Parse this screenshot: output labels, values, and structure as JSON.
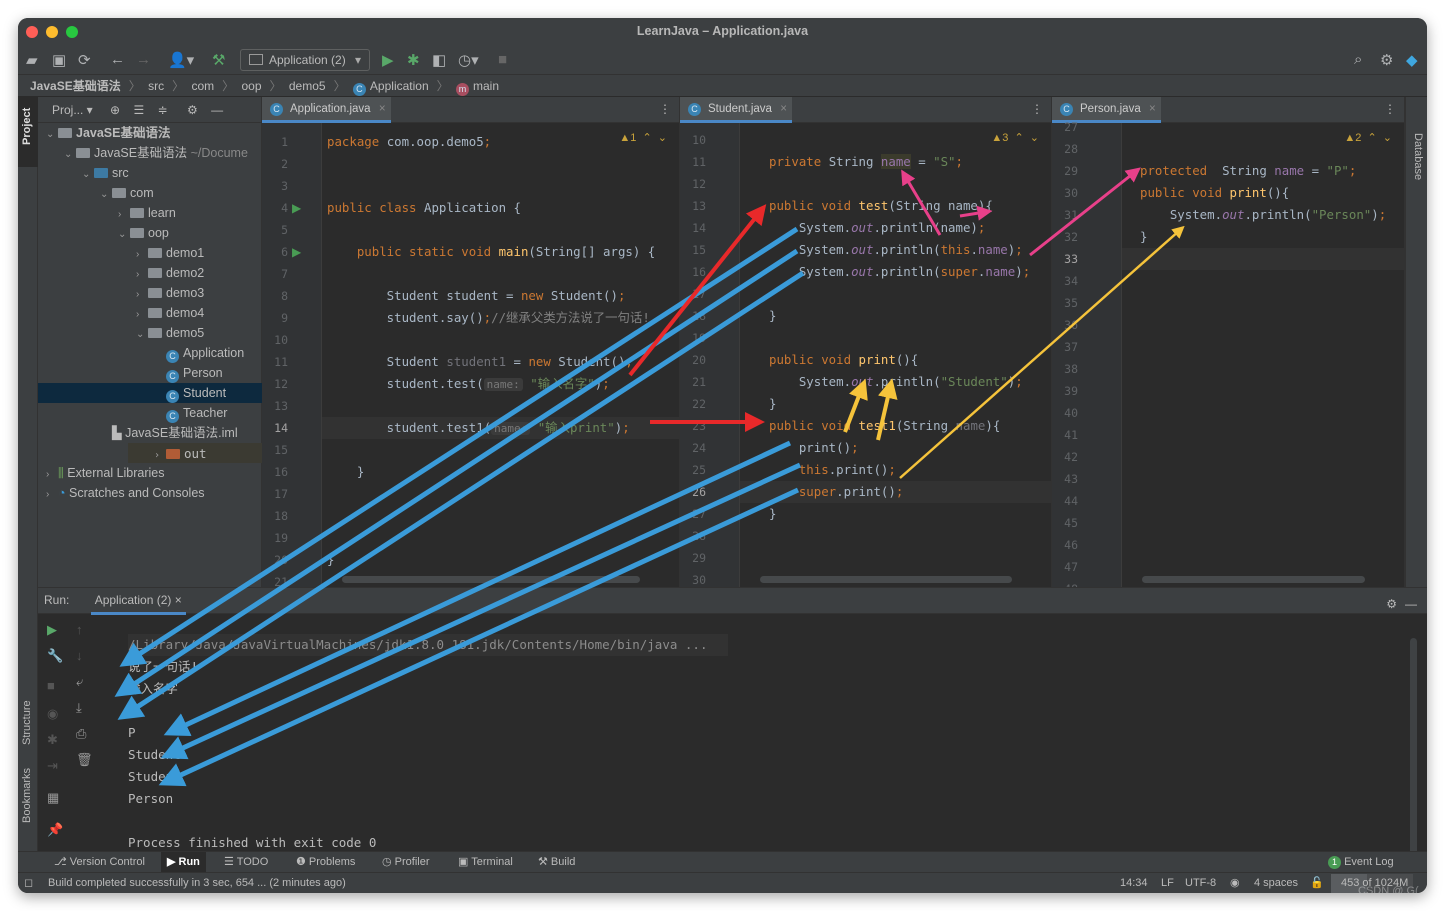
{
  "window": {
    "title": "LearnJava – Application.java"
  },
  "toolbar": {
    "run_config": "Application (2)",
    "icons": [
      "open-folder-icon",
      "save-icon",
      "sync-icon",
      "back-icon",
      "forward-icon",
      "user-icon",
      "build-hammer-icon",
      "run-icon",
      "debug-icon",
      "coverage-icon",
      "profile-icon",
      "stop-icon",
      "search-icon",
      "settings-icon",
      "jetbrains-icon"
    ]
  },
  "breadcrumb": [
    "JavaSE基础语法",
    "src",
    "com",
    "oop",
    "demo5",
    "Application",
    "main"
  ],
  "left_stripe": {
    "project": "Project",
    "structure": "Structure",
    "bookmarks": "Bookmarks"
  },
  "right_stripe": {
    "database": "Database"
  },
  "project": {
    "header": "Proj...",
    "tree": [
      {
        "label": "JavaSE基础语法",
        "depth": 0,
        "chev": "v",
        "kind": "module",
        "bold": true
      },
      {
        "label": "JavaSE基础语法",
        "suffix": "~/Docume",
        "depth": 1,
        "chev": "v",
        "kind": "module"
      },
      {
        "label": "src",
        "depth": 2,
        "chev": "v",
        "kind": "src"
      },
      {
        "label": "com",
        "depth": 3,
        "chev": "v",
        "kind": "pkg"
      },
      {
        "label": "learn",
        "depth": 4,
        "chev": ">",
        "kind": "pkg"
      },
      {
        "label": "oop",
        "depth": 4,
        "chev": "v",
        "kind": "pkg"
      },
      {
        "label": "demo1",
        "depth": 5,
        "chev": ">",
        "kind": "pkg"
      },
      {
        "label": "demo2",
        "depth": 5,
        "chev": ">",
        "kind": "pkg"
      },
      {
        "label": "demo3",
        "depth": 5,
        "chev": ">",
        "kind": "pkg"
      },
      {
        "label": "demo4",
        "depth": 5,
        "chev": ">",
        "kind": "pkg"
      },
      {
        "label": "demo5",
        "depth": 5,
        "chev": "v",
        "kind": "pkg"
      },
      {
        "label": "Application",
        "depth": 6,
        "chev": "",
        "kind": "class"
      },
      {
        "label": "Person",
        "depth": 6,
        "chev": "",
        "kind": "class"
      },
      {
        "label": "Student",
        "depth": 6,
        "chev": "",
        "kind": "class",
        "selected": true
      },
      {
        "label": "Teacher",
        "depth": 6,
        "chev": "",
        "kind": "class"
      },
      {
        "label": "JavaSE基础语法.iml",
        "depth": 3,
        "chev": "",
        "kind": "file"
      },
      {
        "label": "out",
        "depth": 1,
        "chev": ">",
        "kind": "out"
      },
      {
        "label": "External Libraries",
        "depth": 0,
        "chev": ">",
        "kind": "lib"
      },
      {
        "label": "Scratches and Consoles",
        "depth": 0,
        "chev": ">",
        "kind": "scratch"
      }
    ]
  },
  "editors": [
    {
      "tab": "Application.java",
      "warnings": "1",
      "first_line": 1,
      "last_line": 21,
      "current_line": 14,
      "lines": {
        "1": [
          [
            "package ",
            "kw"
          ],
          [
            "com.oop.demo5",
            ""
          ],
          [
            ";",
            "kw"
          ]
        ],
        "4": [
          [
            "public class ",
            "kw"
          ],
          [
            "Application {",
            ""
          ]
        ],
        "6": [
          [
            "    public static void ",
            "kw"
          ],
          [
            "main",
            "mth"
          ],
          [
            "(String[] args) {",
            ""
          ]
        ],
        "8": [
          [
            "        Student student = ",
            ""
          ],
          [
            "new ",
            "kw"
          ],
          [
            "Student()",
            ""
          ],
          [
            ";",
            "kw"
          ]
        ],
        "9": [
          [
            "        student.say()",
            ""
          ],
          [
            ";",
            "kw"
          ],
          [
            "//继承父类方法说了一句话!",
            "cmt"
          ]
        ],
        "11": [
          [
            "        Student ",
            ""
          ],
          [
            "student1",
            "gray"
          ],
          [
            " = ",
            ""
          ],
          [
            "new ",
            "kw"
          ],
          [
            "Student()",
            ""
          ],
          [
            ";",
            "kw"
          ]
        ],
        "12": [
          [
            "        student.test(",
            ""
          ],
          [
            "name:",
            "hint"
          ],
          [
            " \"输入名字\"",
            "str"
          ],
          [
            ")",
            ""
          ],
          [
            ";",
            "kw"
          ]
        ],
        "14": [
          [
            "        student.test1(",
            ""
          ],
          [
            "name:",
            "hint"
          ],
          [
            " \"输入print\"",
            "str"
          ],
          [
            ")",
            ""
          ],
          [
            ";",
            "kw"
          ]
        ],
        "16": [
          [
            "    }",
            ""
          ]
        ],
        "20": [
          [
            "}",
            ""
          ]
        ]
      }
    },
    {
      "tab": "Student.java",
      "warnings": "3",
      "first_line": 10,
      "last_line": 30,
      "current_line": 26,
      "lines": {
        "11": [
          [
            "private ",
            "kw"
          ],
          [
            "String ",
            ""
          ],
          [
            "name",
            "fld hl"
          ],
          [
            " = ",
            ""
          ],
          [
            "\"S\"",
            "str"
          ],
          [
            ";",
            "kw"
          ]
        ],
        "13": [
          [
            "public void ",
            "kw"
          ],
          [
            "test",
            "mth"
          ],
          [
            "(String name){",
            ""
          ]
        ],
        "14": [
          [
            "    System.",
            ""
          ],
          [
            "out",
            "it"
          ],
          [
            ".println(name)",
            ""
          ],
          [
            ";",
            "kw"
          ]
        ],
        "15": [
          [
            "    System.",
            ""
          ],
          [
            "out",
            "it"
          ],
          [
            ".println(",
            ""
          ],
          [
            "this",
            "kw"
          ],
          [
            ".",
            ""
          ],
          [
            "name",
            "fld"
          ],
          [
            ")",
            ""
          ],
          [
            ";",
            "kw"
          ]
        ],
        "16": [
          [
            "    System.",
            ""
          ],
          [
            "out",
            "it"
          ],
          [
            ".println(",
            ""
          ],
          [
            "super",
            "kw"
          ],
          [
            ".",
            ""
          ],
          [
            "name",
            "fld"
          ],
          [
            ")",
            ""
          ],
          [
            ";",
            "kw"
          ]
        ],
        "18": [
          [
            "}",
            ""
          ]
        ],
        "20": [
          [
            "public void ",
            "kw"
          ],
          [
            "print",
            "mth"
          ],
          [
            "(){",
            ""
          ]
        ],
        "21": [
          [
            "    System.",
            ""
          ],
          [
            "out",
            "it"
          ],
          [
            ".println(",
            ""
          ],
          [
            "\"Student\"",
            "str"
          ],
          [
            ")",
            ""
          ],
          [
            ";",
            "kw"
          ]
        ],
        "22": [
          [
            "}",
            ""
          ]
        ],
        "23": [
          [
            "public void ",
            "kw"
          ],
          [
            "test1",
            "mth"
          ],
          [
            "(String ",
            ""
          ],
          [
            "name",
            "gray"
          ],
          [
            "){",
            ""
          ]
        ],
        "24": [
          [
            "    print()",
            ""
          ],
          [
            ";",
            "kw"
          ]
        ],
        "25": [
          [
            "    ",
            ""
          ],
          [
            "this",
            "kw"
          ],
          [
            ".print()",
            ""
          ],
          [
            ";",
            "kw"
          ]
        ],
        "26": [
          [
            "    ",
            ""
          ],
          [
            "super",
            "kw"
          ],
          [
            ".print()",
            ""
          ],
          [
            ";",
            "kw"
          ]
        ],
        "27": [
          [
            "}",
            ""
          ]
        ]
      }
    },
    {
      "tab": "Person.java",
      "warnings": "2",
      "first_line": 27,
      "last_line": 48,
      "current_line": 33,
      "lines": {
        "29": [
          [
            "protected  ",
            "kw"
          ],
          [
            "String ",
            ""
          ],
          [
            "name",
            "fld"
          ],
          [
            " = ",
            ""
          ],
          [
            "\"P\"",
            "str"
          ],
          [
            ";",
            "kw"
          ]
        ],
        "30": [
          [
            "public void ",
            "kw"
          ],
          [
            "print",
            "mth"
          ],
          [
            "(){",
            ""
          ]
        ],
        "31": [
          [
            "    System.",
            ""
          ],
          [
            "out",
            "it"
          ],
          [
            ".println(",
            ""
          ],
          [
            "\"Person\"",
            "str"
          ],
          [
            ")",
            ""
          ],
          [
            ";",
            "kw"
          ]
        ],
        "32": [
          [
            "}",
            ""
          ]
        ]
      }
    }
  ],
  "run": {
    "label": "Run:",
    "tab": "Application (2)",
    "output": [
      "/Library/Java/JavaVirtualMachines/jdk1.8.0_181.jdk/Contents/Home/bin/java ...",
      "说了一句话!",
      "输入名字",
      "S",
      "P",
      "Student",
      "Student",
      "Person",
      "",
      "Process finished with exit code 0"
    ]
  },
  "bottom_tabs": [
    "Version Control",
    "Run",
    "TODO",
    "Problems",
    "Profiler",
    "Terminal",
    "Build"
  ],
  "event_log": {
    "count": "1",
    "label": "Event Log"
  },
  "status": {
    "message": "Build completed successfully in 3 sec, 654 ... (2 minutes ago)",
    "position": "14:34",
    "line_sep": "LF",
    "encoding": "UTF-8",
    "indent": "4 spaces",
    "memory": "453 of 1024M",
    "memory_fraction": 0.44
  },
  "annotation_colors": {
    "blue": "#3a9bd9",
    "red": "#e8292a",
    "pink": "#e8408a",
    "yellow": "#f5c33b"
  },
  "watermark": "CSDN @.G("
}
